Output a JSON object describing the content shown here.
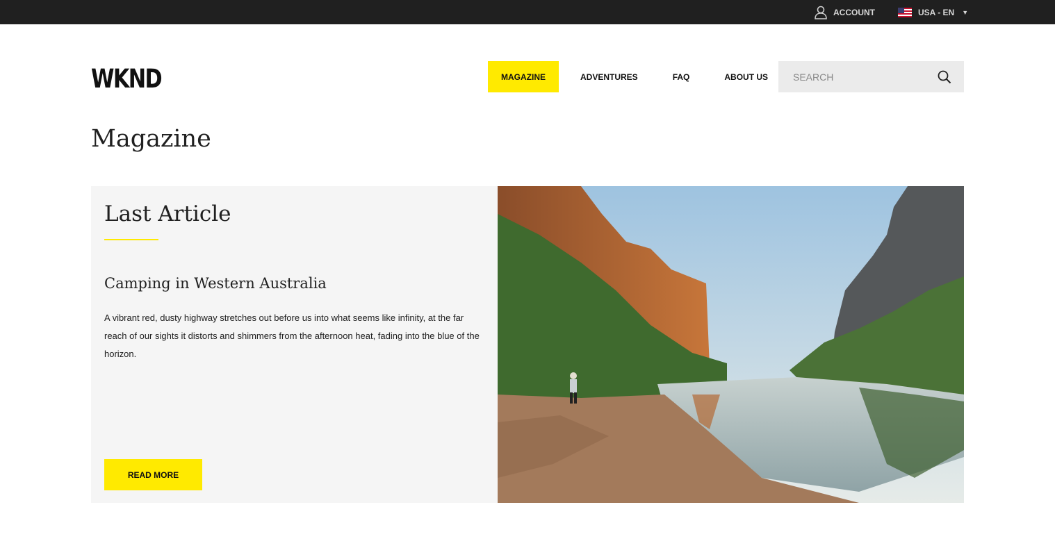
{
  "topbar": {
    "account_label": "ACCOUNT",
    "locale_label": "USA - EN",
    "account_icon": "user-icon",
    "locale_icon": "us-flag-icon"
  },
  "header": {
    "logo": "WKND",
    "nav": [
      "MAGAZINE",
      "ADVENTURES",
      "FAQ",
      "ABOUT US"
    ],
    "active_nav": "MAGAZINE",
    "search_placeholder": "SEARCH",
    "search_icon": "search-icon"
  },
  "main": {
    "page_title": "Magazine",
    "card": {
      "heading": "Last Article",
      "article_title": "Camping in Western Australia",
      "description": "A vibrant red, dusty highway stretches out before us into what seems like infinity, at the far reach of our sights it distorts and shimmers from the afternoon heat, fading into the blue of the horizon.",
      "button_label": "READ MORE"
    }
  },
  "colors": {
    "accent": "#ffea00",
    "topbar_bg": "#202020",
    "card_bg": "#f5f5f5",
    "search_bg": "#ebebeb"
  }
}
